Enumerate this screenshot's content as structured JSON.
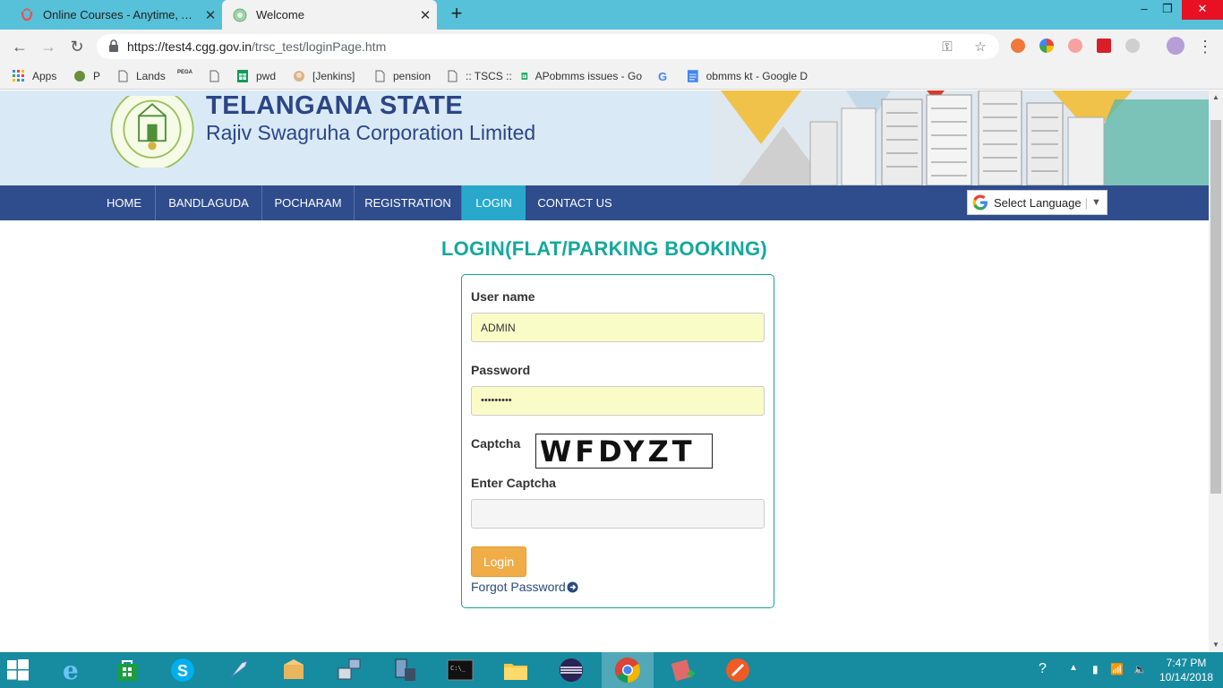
{
  "browser": {
    "tabs": [
      {
        "title": "Online Courses - Anytime, Anywhere",
        "active": false
      },
      {
        "title": "Welcome",
        "active": true
      }
    ],
    "new_tab_label": "+",
    "window_controls": {
      "minimize": "–",
      "restore": "❐",
      "close": "✕"
    },
    "url_host": "https://test4.cgg.gov.in",
    "url_path": "/trsc_test/loginPage.htm"
  },
  "bookmarks": [
    {
      "label": "Apps",
      "icon": "apps-grid-icon"
    },
    {
      "label": "P",
      "icon": "site-icon"
    },
    {
      "label": "Lands",
      "icon": "page-icon"
    },
    {
      "label": "PEGA",
      "icon": "pega-icon"
    },
    {
      "label": "",
      "icon": "page-icon"
    },
    {
      "label": "pwd",
      "icon": "sheets-icon"
    },
    {
      "label": "[Jenkins]",
      "icon": "jenkins-icon"
    },
    {
      "label": "pension",
      "icon": "page-icon"
    },
    {
      "label": ":: TSCS ::",
      "icon": "page-icon"
    },
    {
      "label": "APobmms issues - Go",
      "icon": "sheets-icon"
    },
    {
      "label": "",
      "icon": "google-icon"
    },
    {
      "label": "obmms kt - Google D",
      "icon": "docs-icon"
    }
  ],
  "site": {
    "title": "TELANGANA STATE",
    "subtitle": "Rajiv Swagruha Corporation Limited",
    "emblem_text": "GOVERNMENT OF TELANGANA",
    "nav": [
      {
        "label": "HOME",
        "active": false
      },
      {
        "label": "BANDLAGUDA",
        "active": false
      },
      {
        "label": "POCHARAM",
        "active": false
      },
      {
        "label": "REGISTRATION",
        "active": false
      },
      {
        "label": "LOGIN",
        "active": true
      },
      {
        "label": "CONTACT US",
        "active": false
      }
    ],
    "language": {
      "label": "Select Language",
      "arrow": "▼"
    }
  },
  "login": {
    "heading": "LOGIN(FLAT/PARKING BOOKING)",
    "username_label": "User name",
    "username_value": "ADMIN",
    "password_label": "Password",
    "password_value": "•••••••••",
    "captcha_label": "Captcha",
    "captcha_text": "WFDYZT",
    "enter_captcha_label": "Enter Captcha",
    "enter_captcha_value": "",
    "login_button": "Login",
    "forgot_password": "Forgot Password"
  },
  "taskbar": {
    "clock_time": "7:47 PM",
    "clock_date": "10/14/2018"
  },
  "colors": {
    "tab_strip": "#56c1d9",
    "nav_bar": "#2f4c8c",
    "nav_active": "#29a8cc",
    "heading": "#14a89c",
    "login_button": "#efac47",
    "taskbar": "#178ba0"
  }
}
